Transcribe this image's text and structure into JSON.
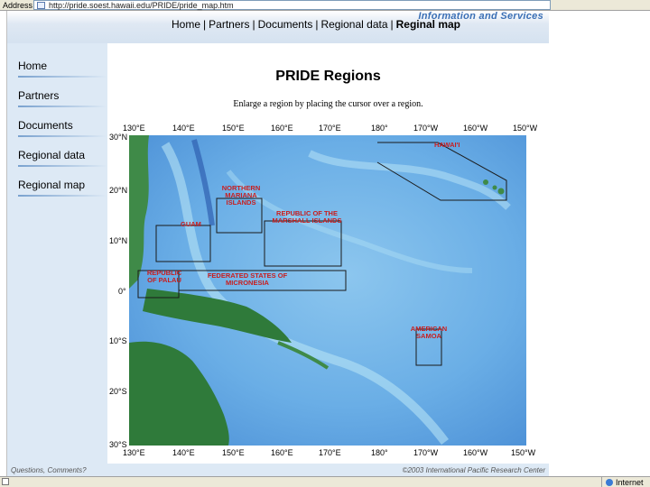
{
  "browser": {
    "address_label": "Address",
    "url": "http://pride.soest.hawaii.edu/PRIDE/pride_map.htm",
    "status_zone": "Internet"
  },
  "banner": {
    "brand_text": "Information and Services"
  },
  "topnav": {
    "items": [
      "Home",
      "Partners",
      "Documents",
      "Regional data",
      "Reginal map"
    ],
    "separator": "|"
  },
  "sidebar": {
    "items": [
      {
        "label": "Home"
      },
      {
        "label": "Partners"
      },
      {
        "label": "Documents"
      },
      {
        "label": "Regional data"
      },
      {
        "label": "Regional map"
      }
    ]
  },
  "main": {
    "title": "PRIDE Regions",
    "instructions": "Enlarge a region by placing the cursor over a region."
  },
  "map": {
    "longitude_labels": [
      "130°E",
      "140°E",
      "150°E",
      "160°E",
      "170°E",
      "180°",
      "170°W",
      "160°W",
      "150°W"
    ],
    "latitude_labels": [
      "30°N",
      "20°N",
      "10°N",
      "0°",
      "10°S",
      "20°S",
      "30°S"
    ],
    "regions": [
      {
        "name": "HAWAI'I"
      },
      {
        "name": "NORTHERN MARIANA ISLANDS"
      },
      {
        "name": "GUAM"
      },
      {
        "name": "REPUBLIC OF THE MARSHALL ISLANDS"
      },
      {
        "name": "REPUBLIC OF PALAU"
      },
      {
        "name": "FEDERATED STATES OF MICRONESIA"
      },
      {
        "name": "AMERICAN SAMOA"
      }
    ],
    "colors": {
      "ocean_deep": "#5a9ee0",
      "ocean_shallow": "#9fd4f0",
      "land": "#2f7a3a",
      "label": "#c81e1e"
    }
  },
  "footer": {
    "left": "Questions, Comments?",
    "right": "©2003 International Pacific Research Center"
  }
}
